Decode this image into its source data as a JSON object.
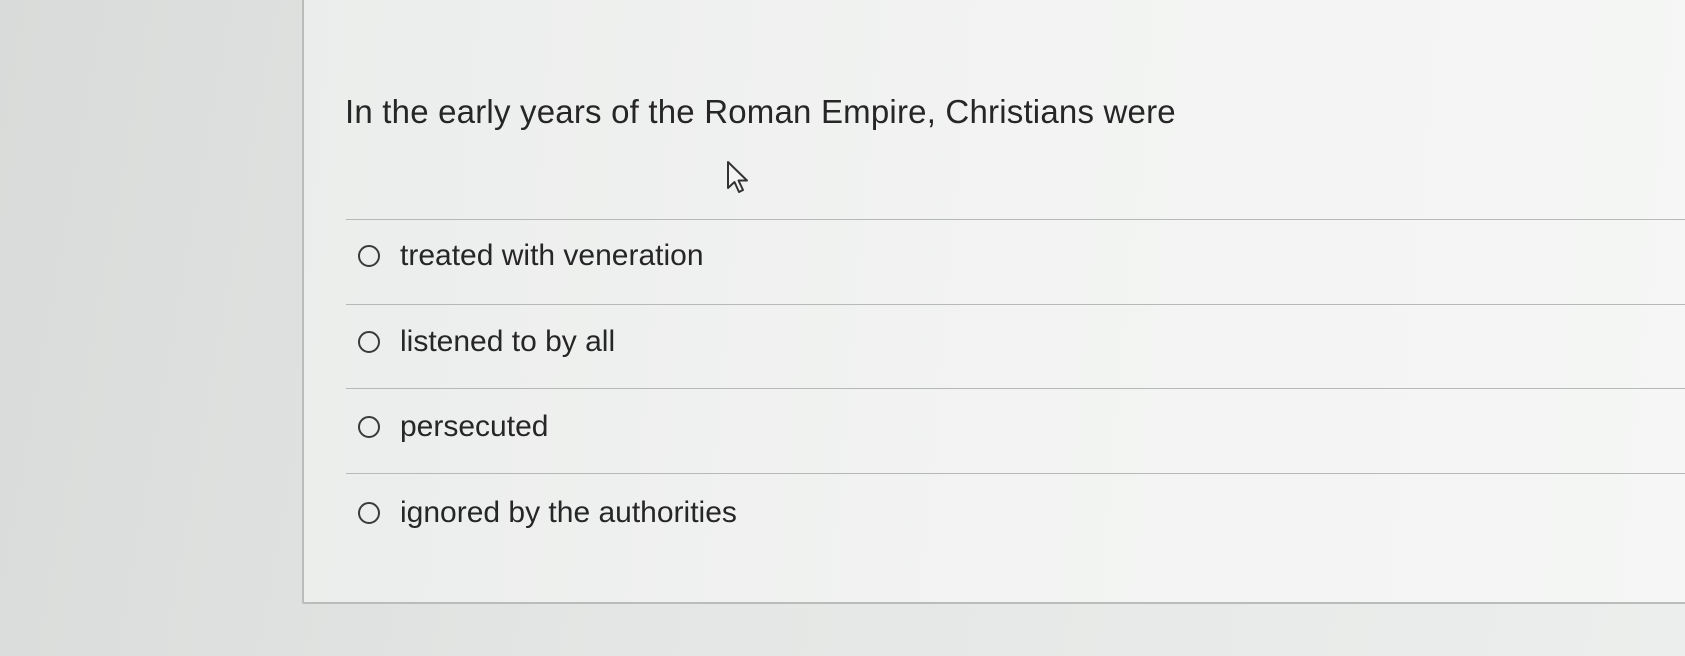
{
  "question": {
    "text": "In the early years of the Roman Empire, Christians were"
  },
  "cursor": {
    "icon": "mouse-pointer-icon"
  },
  "options": [
    {
      "label": "treated with veneration",
      "selected": false
    },
    {
      "label": "listened to by all",
      "selected": false
    },
    {
      "label": "persecuted",
      "selected": false
    },
    {
      "label": "ignored by the authorities",
      "selected": false
    }
  ]
}
